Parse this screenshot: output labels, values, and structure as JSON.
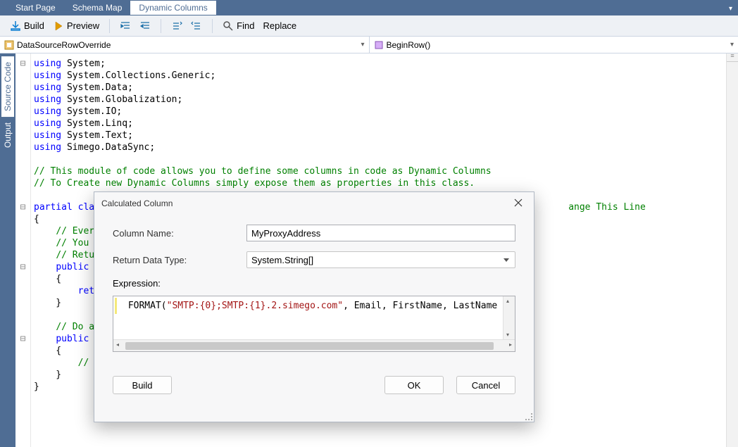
{
  "tabs": {
    "start_page": "Start Page",
    "schema_map": "Schema Map",
    "dynamic_columns": "Dynamic Columns"
  },
  "toolbar": {
    "build": "Build",
    "preview": "Preview",
    "find": "Find",
    "replace": "Replace"
  },
  "dropdowns": {
    "class": "DataSourceRowOverride",
    "method": "BeginRow()"
  },
  "side_tabs": {
    "source_code": "Source Code",
    "output": "Output"
  },
  "code_lines": [
    {
      "t": "using",
      "ns": "System",
      "kind": "using"
    },
    {
      "t": "using",
      "ns": "System.Collections.Generic",
      "kind": "using"
    },
    {
      "t": "using",
      "ns": "System.Data",
      "kind": "using"
    },
    {
      "t": "using",
      "ns": "System.Globalization",
      "kind": "using"
    },
    {
      "t": "using",
      "ns": "System.IO",
      "kind": "using"
    },
    {
      "t": "using",
      "ns": "System.Linq",
      "kind": "using"
    },
    {
      "t": "using",
      "ns": "System.Text",
      "kind": "using"
    },
    {
      "t": "using",
      "ns": "Simego.DataSync",
      "kind": "using"
    }
  ],
  "comments": {
    "c1": "// This module of code allows you to define some columns in code as Dynamic Columns",
    "c2": "// To Create new Dynamic Columns simply expose them as properties in this class.",
    "c3": "//Do Not Change This Line",
    "c4": "// Every",
    "c5": "// You c",
    "c6": "// Retur",
    "c7": "// Do an",
    "c8": "// D"
  },
  "code_frag": {
    "partial_class": "partial class",
    "public_o": "public o",
    "retu": "retu",
    "brace_o": "{",
    "brace_c": "}",
    "ange_suffix": "ange This Line"
  },
  "dialog": {
    "title": "Calculated Column",
    "column_name_label": "Column Name:",
    "column_name_value": "MyProxyAddress",
    "return_type_label": "Return Data Type:",
    "return_type_value": "System.String[]",
    "expression_label": "Expression:",
    "expression_code_prefix": "FORMAT(",
    "expression_code_string": "\"SMTP:{0};SMTP:{1}.2.simego.com\"",
    "expression_code_suffix": ", Email, FirstName, LastName )",
    "build_btn": "Build",
    "ok_btn": "OK",
    "cancel_btn": "Cancel"
  }
}
